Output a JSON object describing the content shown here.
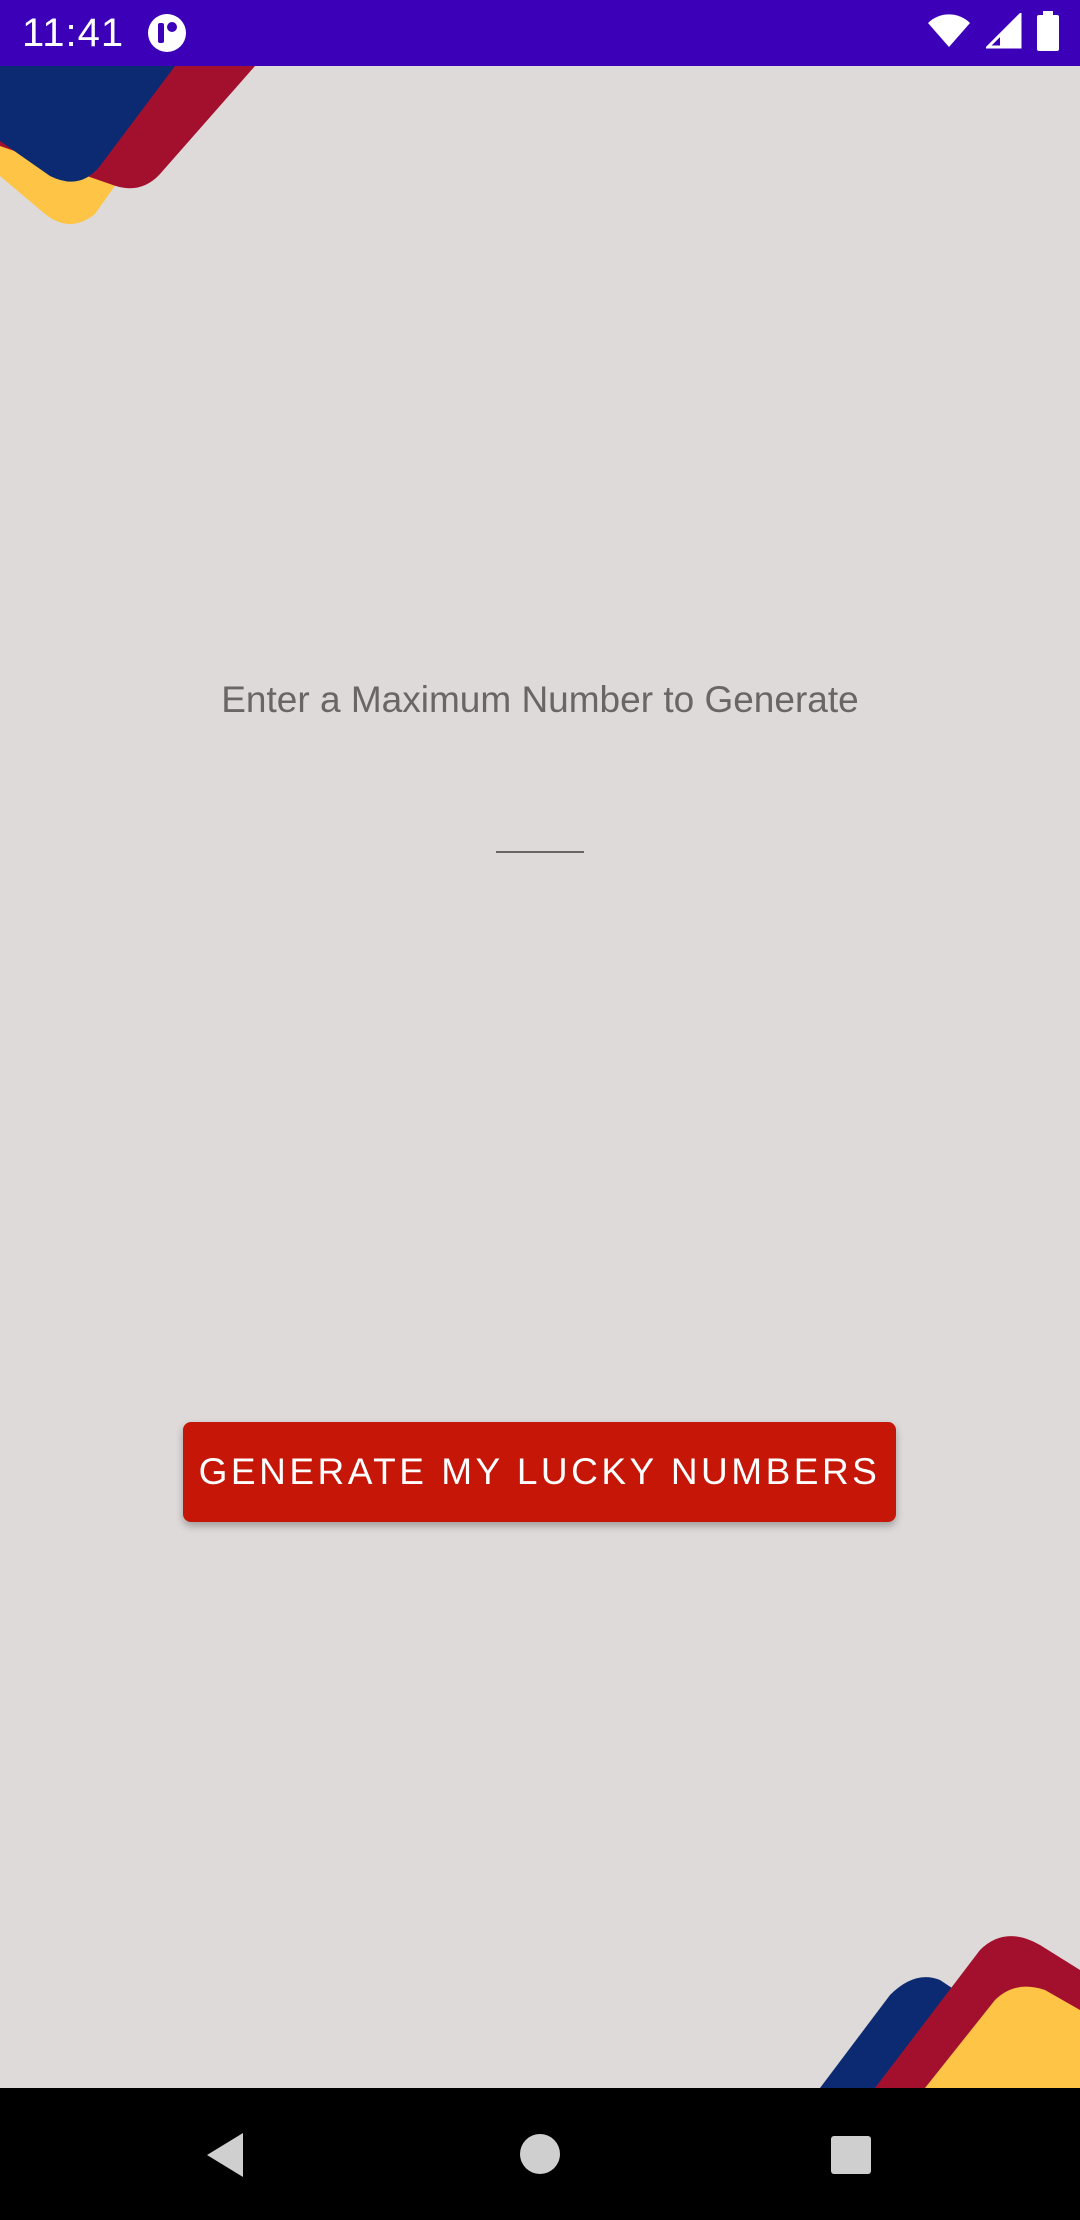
{
  "status_bar": {
    "time": "11:41",
    "icons": [
      "app-notification-icon",
      "wifi-icon",
      "cellular-signal-icon",
      "battery-icon"
    ]
  },
  "main": {
    "prompt_label": "Enter a Maximum Number to Generate",
    "max_number_input": {
      "value": "",
      "placeholder": ""
    },
    "generate_button_label": "GENERATE MY LUCKY NUMBERS"
  },
  "navigation_bar": {
    "icons": [
      "back-icon",
      "home-icon",
      "recents-icon"
    ]
  },
  "colors": {
    "status_bar": "#3c00b8",
    "background": "#dedada",
    "button": "#c51607",
    "accent_navy": "#0c2a72",
    "accent_red": "#a3102e",
    "accent_yellow": "#fec446"
  }
}
